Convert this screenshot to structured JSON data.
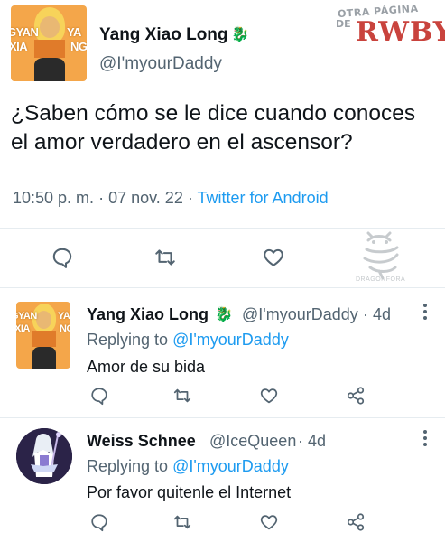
{
  "watermark": {
    "line1": "OTRA PÁGINA",
    "line2": "DE",
    "line3": "RWBY"
  },
  "tweet": {
    "author_name": "Yang Xiao Long",
    "author_handle": "@I'myourDaddy",
    "avatar_text_top_left": "GYAN",
    "avatar_text_top_right": "YA",
    "avatar_text_bottom_left": "XIA",
    "avatar_text_bottom_right": "NG",
    "text": "¿Saben cómo se le dice  cuando conoces el amor verdadero en el ascensor?",
    "time": "10:50 p. m.",
    "date": "07 nov. 22",
    "separator": "·",
    "source": "Twitter for Android",
    "dragon_caption": "DRAGONFORA"
  },
  "replies": [
    {
      "name": "Yang Xiao Long",
      "handle": "@I'myourDaddy",
      "age": "· 4d",
      "replying_prefix": "Replying to",
      "replying_to": "@I'myourDaddy",
      "text": "Amor de su bida"
    },
    {
      "name": "Weiss Schnee",
      "handle": "@IceQueen",
      "age": "· 4d",
      "replying_prefix": "Replying to",
      "replying_to": "@I'myourDaddy",
      "text": "Por favor quitenle el Internet"
    }
  ],
  "icons": {
    "reply": "comment-icon",
    "retweet": "retweet-icon",
    "like": "heart-icon",
    "share": "share-icon",
    "more": "more-vertical-icon",
    "badge": "leaf-icon"
  },
  "colors": {
    "accent": "#1d9bf0",
    "secondary_text": "#536471",
    "watermark_red": "#c9433d"
  }
}
